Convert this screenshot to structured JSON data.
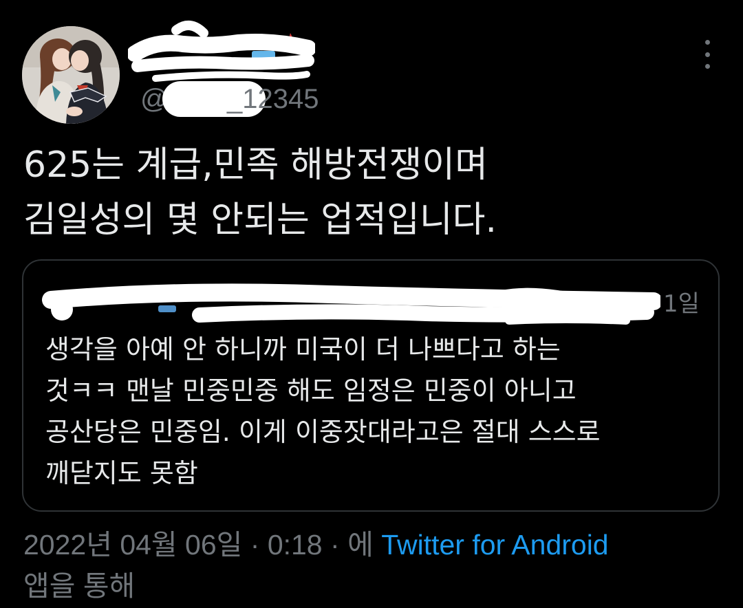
{
  "colors": {
    "background": "#000000",
    "text_primary": "#e7e9ea",
    "text_secondary": "#71767b",
    "link": "#1d9bf0",
    "border": "#2f3336"
  },
  "author": {
    "handle_at": "@",
    "handle_visible": "_12345"
  },
  "tweet": {
    "lines": [
      "625는 계급,민족 해방전쟁이며",
      "김일성의 몇 안되는 업적입니다."
    ]
  },
  "quote": {
    "time": "1일",
    "lines": [
      "생각을 아예 안 하니까 미국이 더 나쁘다고 하는",
      "것ㅋㅋ 맨날 민중민중 해도 임정은 민중이 아니고",
      "공산당은 민중임. 이게 이중잣대라고은 절대 스스로",
      "깨닫지도 못함"
    ]
  },
  "meta": {
    "date": "2022년 04월 06일",
    "sep1": " · ",
    "time": "0:18",
    "sep2": " · ",
    "via_prefix": "에 ",
    "source": "Twitter for Android",
    "via_suffix": "앱을 통해"
  },
  "icons": {
    "more": "more-vertical-icon"
  }
}
